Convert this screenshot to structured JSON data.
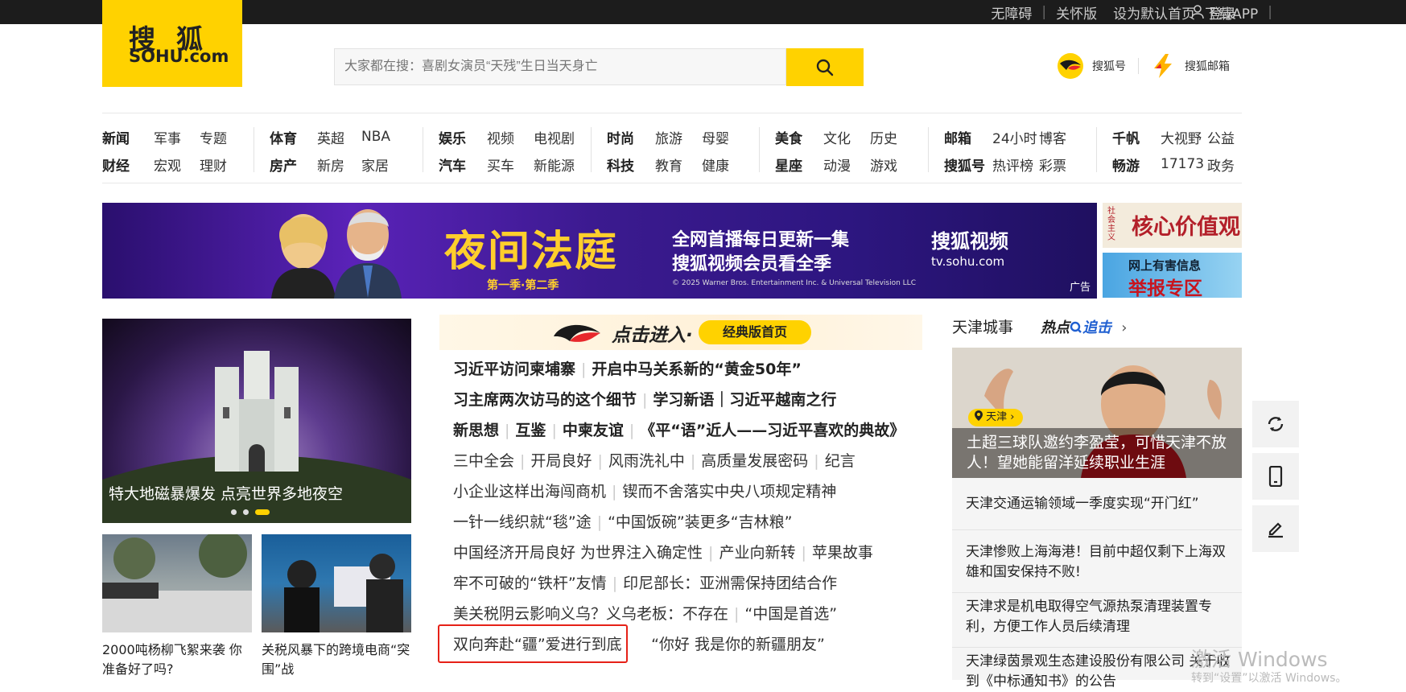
{
  "topbar": {
    "links": [
      "无障碍",
      "关怀版",
      "设为默认首页",
      "下载APP"
    ],
    "login": "登录"
  },
  "logo": {
    "cn": "搜狐",
    "en": "SOHU.com"
  },
  "search": {
    "placeholder": "大家都在搜：喜剧女演员“天残”生日当天身亡"
  },
  "accounts": {
    "sohuhao": "搜狐号",
    "mail": "搜狐邮箱"
  },
  "nav": [
    {
      "row1": [
        "新闻",
        "军事",
        "专题"
      ],
      "row2": [
        "财经",
        "宏观",
        "理财"
      ]
    },
    {
      "row1": [
        "体育",
        "英超",
        "NBA"
      ],
      "row2": [
        "房产",
        "新房",
        "家居"
      ]
    },
    {
      "row1": [
        "娱乐",
        "视频",
        "电视剧"
      ],
      "row2": [
        "汽车",
        "买车",
        "新能源"
      ]
    },
    {
      "row1": [
        "时尚",
        "旅游",
        "母婴"
      ],
      "row2": [
        "科技",
        "教育",
        "健康"
      ]
    },
    {
      "row1": [
        "美食",
        "文化",
        "历史"
      ],
      "row2": [
        "星座",
        "动漫",
        "游戏"
      ]
    },
    {
      "row1": [
        "邮箱",
        "24小时",
        "博客"
      ],
      "row2": [
        "搜狐号",
        "热评榜",
        "彩票"
      ]
    },
    {
      "row1": [
        "千帆",
        "大视野",
        "公益"
      ],
      "row2": [
        "畅游",
        "17173",
        "政务"
      ]
    }
  ],
  "banner": {
    "title": "夜间法庭",
    "season": "第一季·第二季",
    "line1": "全网首播每日更新一集",
    "line2": "搜狐视频会员看全季",
    "copyright": "© 2025 Warner Bros. Entertainment Inc. & Universal Television LLC",
    "brand": "搜狐视频",
    "url": "tv.sohu.com",
    "ad": "广告"
  },
  "side_ads": {
    "core_values": "核心价值观",
    "core_vertical": "社会主义",
    "report_a": "网上有害信息",
    "report_b": "举报专区"
  },
  "hero": {
    "caption": "特大地磁暴爆发 点亮世界多地夜空"
  },
  "thumbs": [
    {
      "caption": "2000吨杨柳飞絮来袭 你准备好了吗?"
    },
    {
      "caption": "关税风暴下的跨境电商“突围”战"
    }
  ],
  "classic": {
    "enter": "点击进入·",
    "pill": "经典版首页"
  },
  "news": [
    {
      "bold": true,
      "items": [
        "习近平访问柬埔寨",
        "开启中马关系新的“黄金50年”"
      ]
    },
    {
      "bold": true,
      "items": [
        "习主席两次访马的这个细节",
        "学习新语｜习近平越南之行"
      ]
    },
    {
      "bold": true,
      "items": [
        "新思想",
        "互鉴",
        "中柬友谊",
        "《平“语”近人——习近平喜欢的典故》"
      ]
    },
    {
      "bold": false,
      "items": [
        "三中全会",
        "开局良好",
        "风雨洗礼中",
        "高质量发展密码",
        "纪言"
      ]
    },
    {
      "bold": false,
      "items": [
        "小企业这样出海闯商机",
        "锲而不舍落实中央八项规定精神"
      ]
    },
    {
      "bold": false,
      "items": [
        "一针一线织就“毯”途",
        "“中国饭碗”装更多“吉林粮”"
      ]
    },
    {
      "bold": false,
      "items": [
        "中国经济开局良好 为世界注入确定性",
        "产业向新转",
        "苹果故事"
      ]
    },
    {
      "bold": false,
      "items": [
        "牢不可破的“铁杆”友情",
        "印尼部长：亚洲需保持团结合作"
      ]
    },
    {
      "bold": false,
      "items": [
        "美关税阴云影响义乌？义乌老板：不存在",
        "“中国是首选”"
      ]
    },
    {
      "bold": false,
      "items": [
        "双向奔赴“疆”爱进行到底",
        "“你好 我是你的新疆朋友”"
      ]
    }
  ],
  "tianjin": {
    "header": "天津城事",
    "hot_a": "热点",
    "hot_b": "追击",
    "tag": "天津",
    "img_caption": "土超三球队邀约李盈莹，可惜天津不放人！望她能留洋延续职业生涯",
    "items": [
      "天津交通运输领域一季度实现“开门红”",
      "天津惨败上海海港！目前中超仅剩下上海双雄和国安保持不败!",
      "天津求是机电取得空气源热泵清理装置专利，方便工作人员后续清理",
      "天津绿茵景观生态建设股份有限公司 关于收到《中标通知书》的公告"
    ]
  },
  "watermark": {
    "line1": "激活 Windows",
    "line2": "转到“设置”以激活 Windows。"
  }
}
